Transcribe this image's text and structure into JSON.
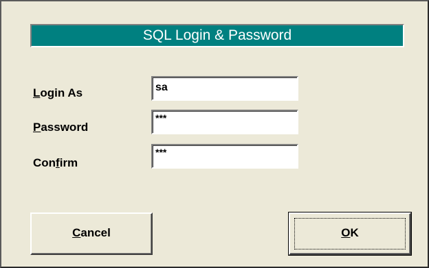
{
  "dialog": {
    "title": "SQL Login & Password"
  },
  "fields": {
    "login": {
      "label_underlined": "L",
      "label_rest": "ogin As",
      "value": "sa"
    },
    "password": {
      "label_underlined": "P",
      "label_rest": "assword",
      "value": "***"
    },
    "confirm": {
      "label_before": "Con",
      "label_underlined": "f",
      "label_rest": "irm",
      "value": "***"
    }
  },
  "buttons": {
    "cancel": {
      "underlined": "C",
      "rest": "ancel"
    },
    "ok": {
      "underlined": "O",
      "rest": "K"
    }
  }
}
